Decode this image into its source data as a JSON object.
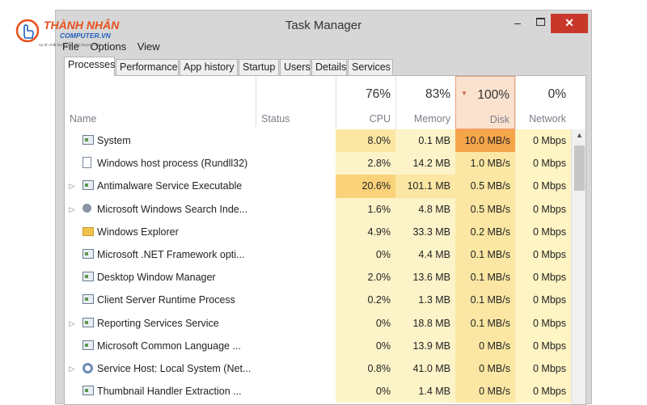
{
  "watermark": {
    "brand": "THÀNH NHÂN",
    "sub": "COMPUTER.VN",
    "tagline": "Uy tín chất lượng tạo nên thương hiệu"
  },
  "window": {
    "title": "Task Manager",
    "minimize": "–",
    "close": "✕"
  },
  "menu": [
    "File",
    "Options",
    "View"
  ],
  "tabs": [
    "Processes",
    "Performance",
    "App history",
    "Startup",
    "Users",
    "Details",
    "Services"
  ],
  "active_tab": "Processes",
  "columns": {
    "name": "Name",
    "status": "Status",
    "cpu": {
      "percent": "76%",
      "label": "CPU"
    },
    "memory": {
      "percent": "83%",
      "label": "Memory"
    },
    "disk": {
      "percent": "100%",
      "label": "Disk"
    },
    "network": {
      "percent": "0%",
      "label": "Network"
    }
  },
  "colors": {
    "cpu_light": "#fdf3c8",
    "cpu_mid": "#fbe7a3",
    "cpu_high": "#f9d27a",
    "disk_high": "#f5a54a",
    "net": "#fff4c4",
    "close_red": "#c7382a"
  },
  "rows": [
    {
      "name": "System",
      "icon": "app-icon",
      "expandable": false,
      "cpu": "8.0%",
      "memory": "0.1 MB",
      "disk": "10.0 MB/s",
      "network": "0 Mbps",
      "cpu_level": "mid",
      "mem_level": "light",
      "disk_level": "high"
    },
    {
      "name": "Windows host process (Rundll32)",
      "icon": "document-icon",
      "expandable": false,
      "cpu": "2.8%",
      "memory": "14.2 MB",
      "disk": "1.0 MB/s",
      "network": "0 Mbps",
      "cpu_level": "light",
      "mem_level": "light",
      "disk_level": "light"
    },
    {
      "name": "Antimalware Service Executable",
      "icon": "app-icon",
      "expandable": true,
      "cpu": "20.6%",
      "memory": "101.1 MB",
      "disk": "0.5 MB/s",
      "network": "0 Mbps",
      "cpu_level": "high",
      "mem_level": "mid",
      "disk_level": "light"
    },
    {
      "name": "Microsoft Windows Search Inde...",
      "icon": "user-icon",
      "expandable": true,
      "cpu": "1.6%",
      "memory": "4.8 MB",
      "disk": "0.5 MB/s",
      "network": "0 Mbps",
      "cpu_level": "light",
      "mem_level": "light",
      "disk_level": "light"
    },
    {
      "name": "Windows Explorer",
      "icon": "folder-icon",
      "expandable": false,
      "cpu": "4.9%",
      "memory": "33.3 MB",
      "disk": "0.2 MB/s",
      "network": "0 Mbps",
      "cpu_level": "light",
      "mem_level": "light",
      "disk_level": "light"
    },
    {
      "name": "Microsoft .NET Framework opti...",
      "icon": "app-icon",
      "expandable": false,
      "cpu": "0%",
      "memory": "4.4 MB",
      "disk": "0.1 MB/s",
      "network": "0 Mbps",
      "cpu_level": "light",
      "mem_level": "light",
      "disk_level": "light"
    },
    {
      "name": "Desktop Window Manager",
      "icon": "app-icon",
      "expandable": false,
      "cpu": "2.0%",
      "memory": "13.6 MB",
      "disk": "0.1 MB/s",
      "network": "0 Mbps",
      "cpu_level": "light",
      "mem_level": "light",
      "disk_level": "light"
    },
    {
      "name": "Client Server Runtime Process",
      "icon": "app-icon",
      "expandable": false,
      "cpu": "0.2%",
      "memory": "1.3 MB",
      "disk": "0.1 MB/s",
      "network": "0 Mbps",
      "cpu_level": "light",
      "mem_level": "light",
      "disk_level": "light"
    },
    {
      "name": "Reporting Services Service",
      "icon": "app-icon",
      "expandable": true,
      "cpu": "0%",
      "memory": "18.8 MB",
      "disk": "0.1 MB/s",
      "network": "0 Mbps",
      "cpu_level": "light",
      "mem_level": "light",
      "disk_level": "light"
    },
    {
      "name": "Microsoft Common Language ...",
      "icon": "app-icon",
      "expandable": false,
      "cpu": "0%",
      "memory": "13.9 MB",
      "disk": "0 MB/s",
      "network": "0 Mbps",
      "cpu_level": "light",
      "mem_level": "light",
      "disk_level": "light"
    },
    {
      "name": "Service Host: Local System (Net...",
      "icon": "gear-icon",
      "expandable": true,
      "cpu": "0.8%",
      "memory": "41.0 MB",
      "disk": "0 MB/s",
      "network": "0 Mbps",
      "cpu_level": "light",
      "mem_level": "light",
      "disk_level": "light"
    },
    {
      "name": "Thumbnail Handler Extraction ...",
      "icon": "app-icon",
      "expandable": false,
      "cpu": "0%",
      "memory": "1.4 MB",
      "disk": "0 MB/s",
      "network": "0 Mbps",
      "cpu_level": "light",
      "mem_level": "light",
      "disk_level": "light"
    }
  ]
}
